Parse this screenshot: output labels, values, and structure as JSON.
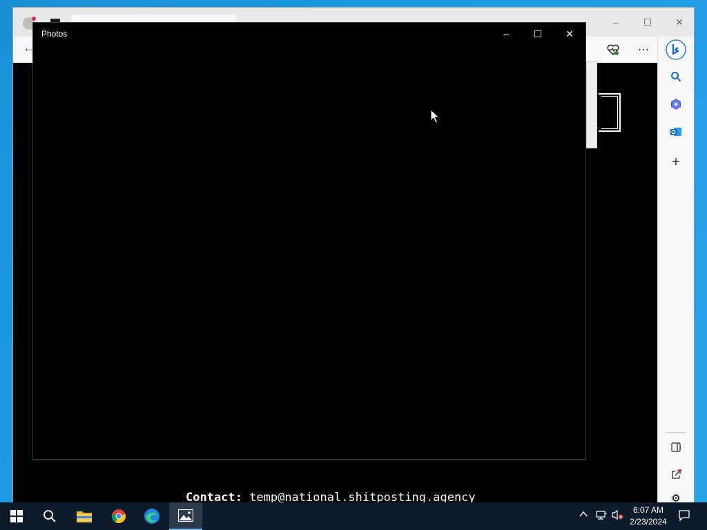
{
  "photos_window": {
    "title": "Photos",
    "minimize_glyph": "–",
    "maximize_glyph": "☐",
    "close_glyph": "✕"
  },
  "browser": {
    "page_contact_label": "Contact:",
    "page_contact_email": "temp@national.shitposting.agency"
  },
  "taskbar": {
    "items": [
      "start-icon",
      "search-icon",
      "file-explorer-icon",
      "chrome-icon",
      "edge-icon",
      "photos-icon"
    ],
    "clock_time": "6:07 AM",
    "clock_date": "2/23/2024"
  },
  "colors": {
    "desktop": "#1e9be4",
    "taskbar": "#0e1b2b",
    "photos_bg": "#000000"
  }
}
